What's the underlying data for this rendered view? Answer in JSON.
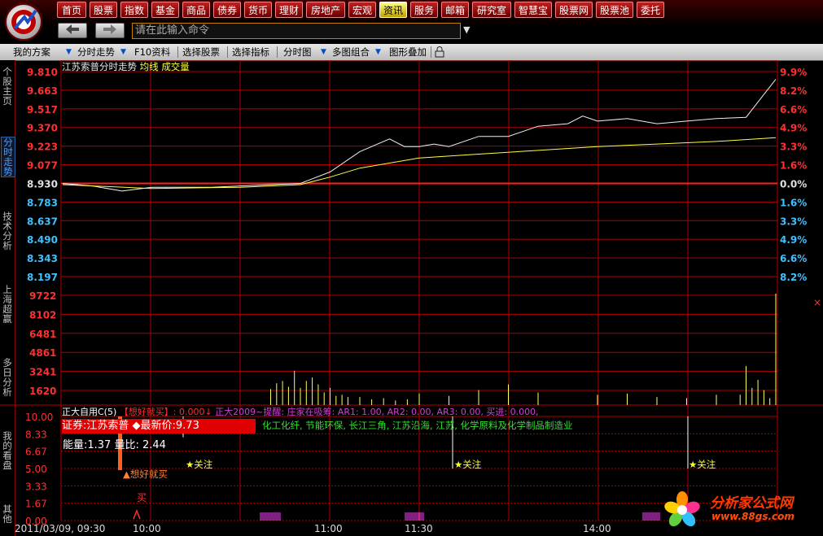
{
  "nav": {
    "buttons": [
      "首页",
      "股票",
      "指数",
      "基金",
      "商品",
      "债券",
      "货币",
      "理财",
      "房地产",
      "宏观",
      "资讯",
      "服务",
      "邮箱",
      "研究室",
      "智慧宝",
      "股票网",
      "股票池",
      "委托"
    ],
    "highlighted": "资讯"
  },
  "command": {
    "placeholder": "请在此输入命令"
  },
  "toolbar": {
    "items": [
      "我的方案",
      "分时走势",
      "F10资料",
      "选择股票",
      "选择指标",
      "分时图",
      "多图组合",
      "图形叠加"
    ]
  },
  "left_tabs": [
    "个股主页",
    "分时走势",
    "技术分析",
    "上海超赢",
    "多日分析",
    "我的看盘",
    "其他"
  ],
  "active_tab": "分时走势",
  "chart": {
    "title": "江苏索普分时走势",
    "legend_avg": "均线",
    "legend_vol": "成交量",
    "price_ticks": [
      "9.810",
      "9.663",
      "9.517",
      "9.370",
      "9.223",
      "9.077",
      "8.930",
      "8.783",
      "8.637",
      "8.490",
      "8.343",
      "8.197"
    ],
    "pct_ticks": [
      "9.9%",
      "8.2%",
      "6.6%",
      "4.9%",
      "3.3%",
      "1.6%",
      "0.0%",
      "1.6%",
      "3.3%",
      "4.9%",
      "6.6%",
      "8.2%"
    ],
    "volume_ticks": [
      "9722",
      "8102",
      "6481",
      "4861",
      "3241",
      "1620"
    ],
    "x_date_time": "2011/03/09, 09:30",
    "x_ticks": [
      "10:00",
      "11:00",
      "11:30",
      "14:00"
    ]
  },
  "chart_data": {
    "type": "line",
    "title": "江苏索普分时走势",
    "ylim": [
      8.197,
      9.81
    ],
    "prev_close": 8.93,
    "series": [
      {
        "name": "价格",
        "x": [
          0,
          10,
          20,
          30,
          40,
          50,
          60,
          70,
          80,
          90,
          100,
          110,
          115,
          120,
          125,
          130,
          140,
          150,
          160,
          170,
          175,
          180,
          190,
          200,
          210,
          220,
          230,
          240
        ],
        "values": [
          8.93,
          8.91,
          8.87,
          8.9,
          8.9,
          8.9,
          8.91,
          8.92,
          8.93,
          9.02,
          9.18,
          9.28,
          9.22,
          9.22,
          9.24,
          9.22,
          9.3,
          9.3,
          9.38,
          9.4,
          9.46,
          9.42,
          9.44,
          9.4,
          9.42,
          9.44,
          9.45,
          9.75
        ]
      },
      {
        "name": "均线",
        "x": [
          0,
          30,
          60,
          80,
          90,
          100,
          120,
          140,
          160,
          180,
          200,
          220,
          240
        ],
        "values": [
          8.92,
          8.89,
          8.9,
          8.92,
          8.98,
          9.05,
          9.13,
          9.16,
          9.19,
          9.22,
          9.24,
          9.26,
          9.29
        ]
      }
    ],
    "volume": {
      "ylim": [
        0,
        9722
      ],
      "x": [
        70,
        72,
        74,
        76,
        78,
        80,
        82,
        84,
        86,
        88,
        90,
        92,
        94,
        96,
        100,
        104,
        108,
        112,
        116,
        120,
        130,
        140,
        150,
        160,
        180,
        190,
        200,
        210,
        220,
        228,
        230,
        232,
        234,
        236,
        238,
        240
      ],
      "values": [
        1400,
        1900,
        2100,
        1600,
        3000,
        1500,
        2100,
        2400,
        1800,
        1100,
        1500,
        800,
        900,
        700,
        700,
        500,
        600,
        400,
        500,
        1000,
        800,
        1300,
        1800,
        1100,
        900,
        1000,
        700,
        600,
        900,
        900,
        3400,
        1500,
        2200,
        1300,
        600,
        9722
      ]
    }
  },
  "indicator": {
    "name": "正大自用C(5)",
    "signal": "【想好就买】: 0.000↓",
    "hint": "正大2009~提醒: 庄家在吸筹: AR1: 1.00, AR2: 0.00, AR3: 0.00, 买进: 0.000,",
    "stock_box": "证券:江苏索普 ◆最新价:9.73",
    "sectors": "化工化纤, 节能环保, 长江三角, 江苏沿海, 江苏, 化学原料及化学制品制造业",
    "volume_ratio": "能量:1.37 量比: 2.44",
    "y_ticks": [
      "10.00",
      "8.33",
      "6.67",
      "5.00",
      "3.33",
      "1.67",
      "0.00"
    ],
    "buy_label": "想好就买",
    "buy_char": "买",
    "focus_labels": [
      "★关注",
      "★关注",
      "★关注"
    ]
  },
  "watermark": {
    "name": "分析家公式网",
    "url": "www.88gs.com"
  }
}
